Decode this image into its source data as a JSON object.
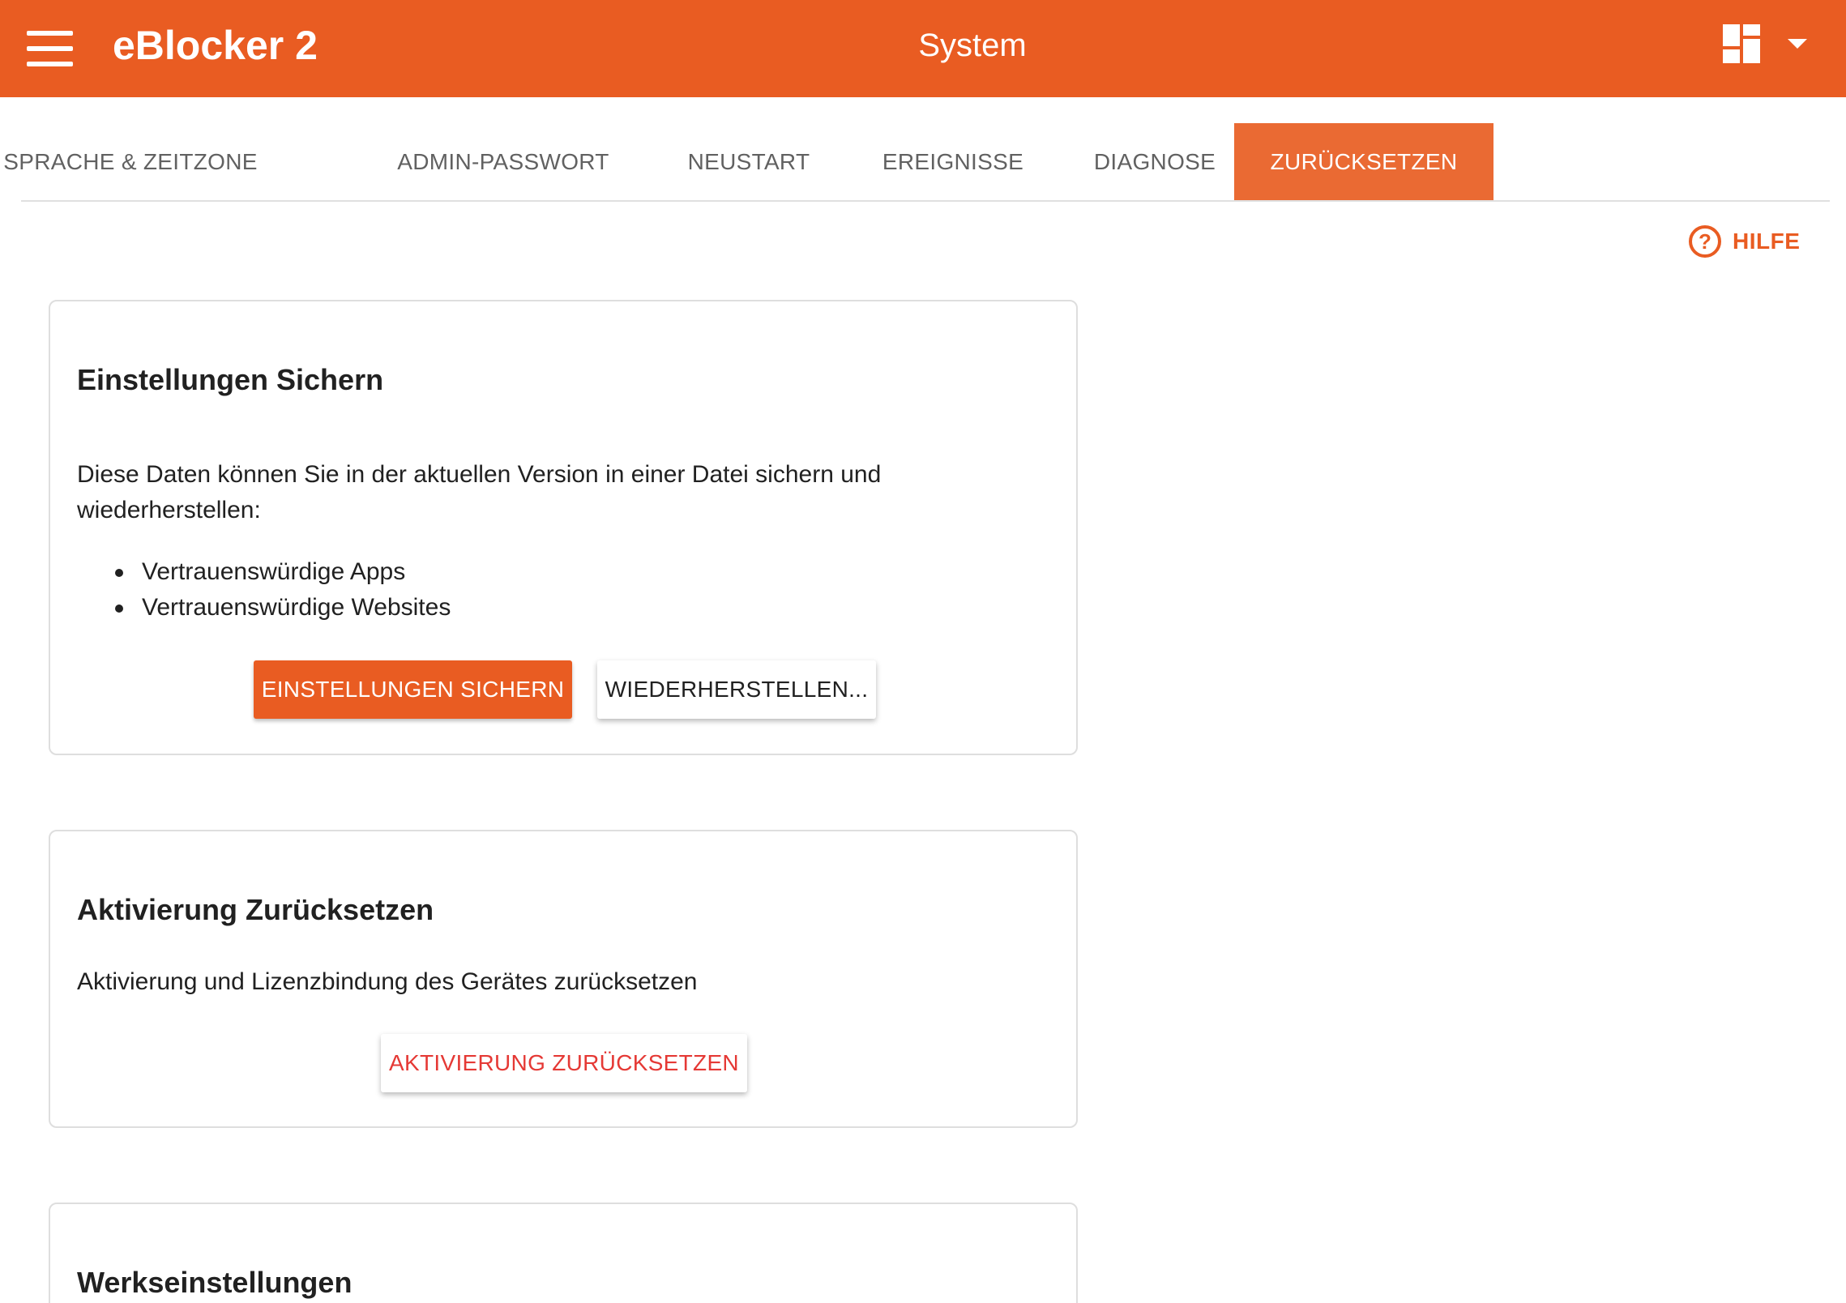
{
  "header": {
    "app_title": "eBlocker 2",
    "page_title": "System",
    "icons": [
      "menu-icon",
      "dashboard-icon",
      "caret-down-icon"
    ],
    "accent_color": "#e95c22"
  },
  "tabs": [
    {
      "label": "SPRACHE & ZEITZONE",
      "active": false
    },
    {
      "label": "ADMIN-PASSWORT",
      "active": false
    },
    {
      "label": "NEUSTART",
      "active": false
    },
    {
      "label": "EREIGNISSE",
      "active": false
    },
    {
      "label": "DIAGNOSE",
      "active": false
    },
    {
      "label": "ZURÜCKSETZEN",
      "active": true
    }
  ],
  "help": {
    "icon_glyph": "?",
    "label": "HILFE"
  },
  "cards": {
    "backup": {
      "title": "Einstellungen Sichern",
      "description": "Diese Daten können Sie in der aktuellen Version in einer Datei sichern und wiederherstellen:",
      "items": [
        "Vertrauenswürdige Apps",
        "Vertrauenswürdige Websites"
      ],
      "save_button": "EINSTELLUNGEN SICHERN",
      "restore_button": "WIEDERHERSTELLEN..."
    },
    "activation": {
      "title": "Aktivierung Zurücksetzen",
      "description": "Aktivierung und Lizenzbindung des Gerätes zurücksetzen",
      "reset_button": "AKTIVIERUNG ZURÜCKSETZEN",
      "reset_button_color": "#e53935"
    },
    "factory": {
      "title": "Werkseinstellungen"
    }
  }
}
